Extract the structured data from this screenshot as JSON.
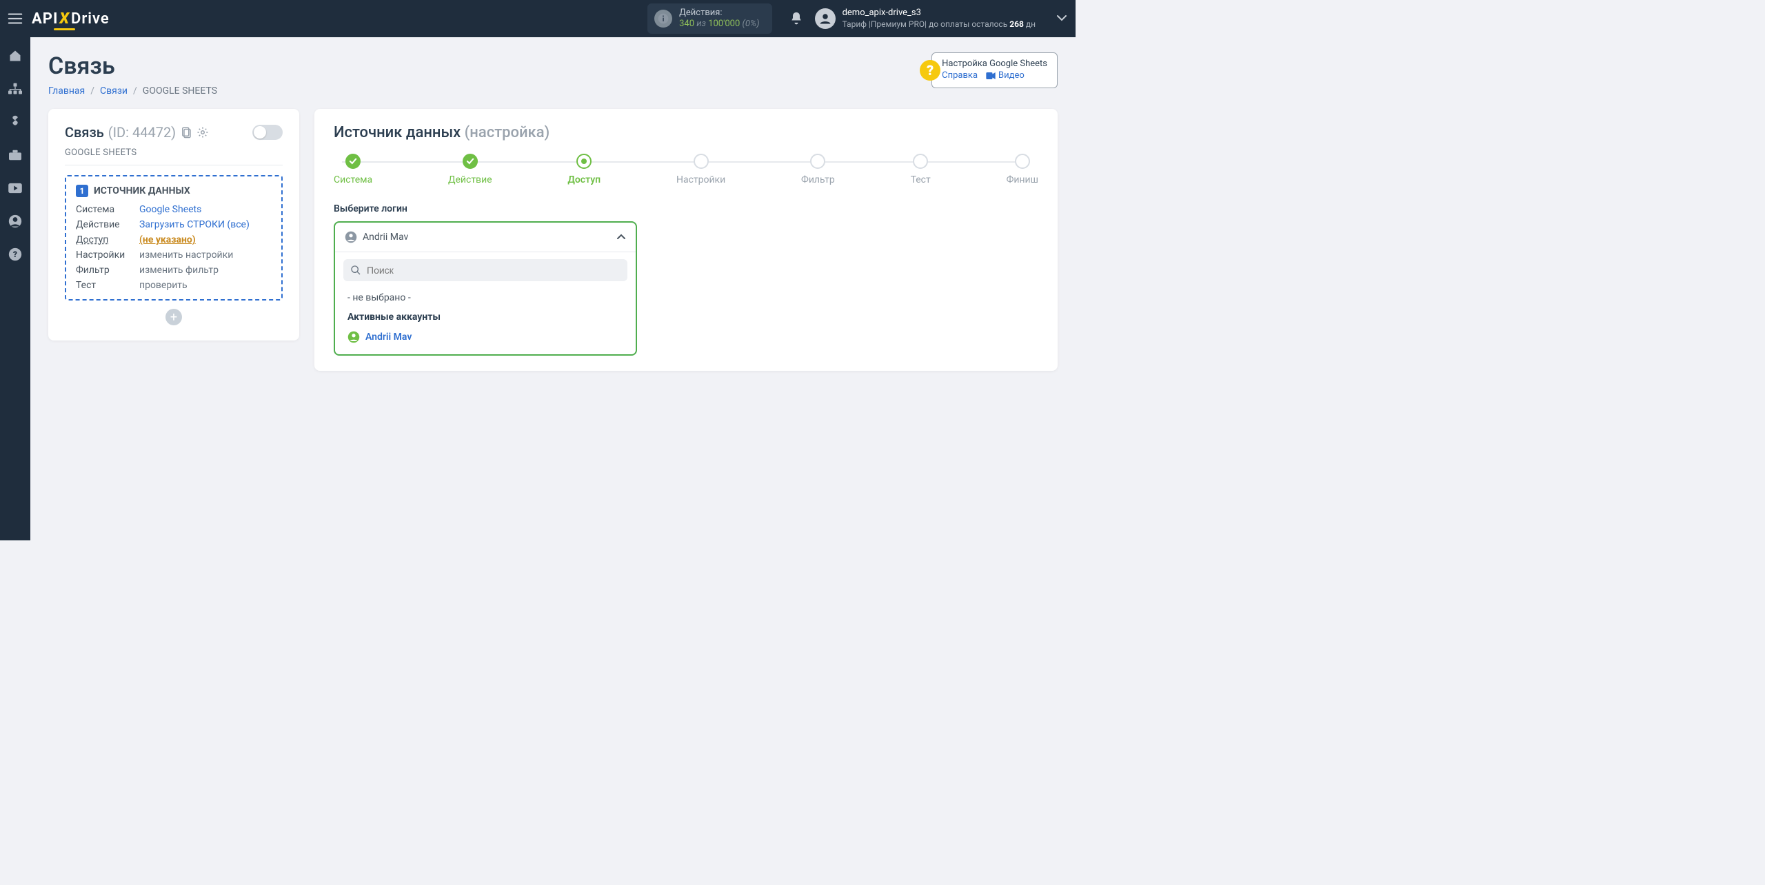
{
  "topbar": {
    "actions": {
      "label": "Действия:",
      "used": "340",
      "of_word": "из",
      "limit": "100'000",
      "percent": "(0%)"
    },
    "profile": {
      "name": "demo_apix-drive_s3",
      "plan_prefix": "Тариф |",
      "plan_name": "Премиум PRO",
      "plan_suffix": "| до оплаты осталось ",
      "days": "268",
      "days_unit": " дн"
    }
  },
  "page": {
    "title": "Связь",
    "breadcrumb": {
      "home": "Главная",
      "links": "Связи",
      "current": "GOOGLE SHEETS"
    }
  },
  "help": {
    "title": "Настройка Google Sheets",
    "link_ref": "Справка",
    "link_video": "Видео"
  },
  "left": {
    "title": "Связь",
    "id": "(ID: 44472)",
    "subtitle": "GOOGLE SHEETS",
    "source": {
      "heading": "ИСТОЧНИК ДАННЫХ",
      "rows": {
        "system": {
          "k": "Система",
          "v": "Google Sheets"
        },
        "action": {
          "k": "Действие",
          "v": "Загрузить СТРОКИ (все)"
        },
        "access": {
          "k": "Доступ",
          "v": "(не указано)"
        },
        "settings": {
          "k": "Настройки",
          "v": "изменить настройки"
        },
        "filter": {
          "k": "Фильтр",
          "v": "изменить фильтр"
        },
        "test": {
          "k": "Тест",
          "v": "проверить"
        }
      }
    }
  },
  "right": {
    "title": "Источник данных",
    "subtitle": "(настройка)",
    "steps": {
      "system": "Система",
      "action": "Действие",
      "access": "Доступ",
      "settings": "Настройки",
      "filter": "Фильтр",
      "test": "Тест",
      "finish": "Финиш"
    },
    "field_label": "Выберите логин",
    "select": {
      "value": "Andrii Mav",
      "search_placeholder": "Поиск",
      "none": "- не выбрано -",
      "group": "Активные аккаунты",
      "account": "Andrii Mav"
    }
  }
}
